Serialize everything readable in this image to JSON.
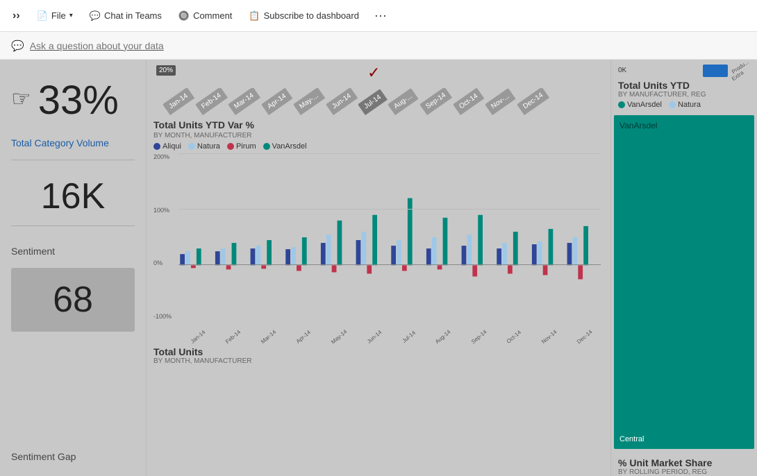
{
  "toolbar": {
    "chevron_label": "›",
    "file_label": "File",
    "chat_label": "Chat in Teams",
    "comment_label": "Comment",
    "subscribe_label": "Subscribe to dashboard",
    "more_label": "···"
  },
  "search": {
    "placeholder": "Ask a question about your data"
  },
  "left": {
    "percent": "33%",
    "category_label": "Total Category Volume",
    "units": "16K",
    "sentiment_label": "Sentiment",
    "sentiment_value": "68",
    "sentiment_gap_label": "Sentiment Gap"
  },
  "mid_slider": {
    "pct": "20%",
    "months": [
      "Jan-14",
      "Feb-14",
      "Mar-14",
      "Apr-14",
      "May-...",
      "Jun-14",
      "Jul-14",
      "Aug-...",
      "Sep-14",
      "Oct-14",
      "Nov-...",
      "Dec-14"
    ]
  },
  "chart": {
    "title": "Total Units YTD Var %",
    "subtitle": "BY MONTH, MANUFACTURER",
    "legend": [
      {
        "name": "Aliqui",
        "color": "#2e4698"
      },
      {
        "name": "Natura",
        "color": "#9ec8e8"
      },
      {
        "name": "Pirum",
        "color": "#c0334d"
      },
      {
        "name": "VanArsdel",
        "color": "#00897b"
      }
    ],
    "y_labels": [
      "200%",
      "100%",
      "0%",
      "-100%"
    ],
    "x_labels": [
      "Jan-14",
      "Feb-14",
      "Mar-14",
      "Apr-14",
      "May-14",
      "Jun-14",
      "Jul-14",
      "Aug-14",
      "Sep-14",
      "Oct-14",
      "Nov-14",
      "Dec-14"
    ],
    "bar_groups": [
      {
        "aliqui": 20,
        "natura": 25,
        "pirum": -5,
        "vanarsdel": 30
      },
      {
        "aliqui": 25,
        "natura": 30,
        "pirum": -8,
        "vanarsdel": 40
      },
      {
        "aliqui": 30,
        "natura": 35,
        "pirum": -6,
        "vanarsdel": 45
      },
      {
        "aliqui": 28,
        "natura": 32,
        "pirum": -10,
        "vanarsdel": 50
      },
      {
        "aliqui": 40,
        "natura": 55,
        "pirum": -12,
        "vanarsdel": 80
      },
      {
        "aliqui": 45,
        "natura": 60,
        "pirum": -15,
        "vanarsdel": 90
      },
      {
        "aliqui": 35,
        "natura": 45,
        "pirum": -10,
        "vanarsdel": 120
      },
      {
        "aliqui": 30,
        "natura": 50,
        "pirum": -8,
        "vanarsdel": 85
      },
      {
        "aliqui": 35,
        "natura": 55,
        "pirum": -20,
        "vanarsdel": 90
      },
      {
        "aliqui": 30,
        "natura": 40,
        "pirum": -15,
        "vanarsdel": 60
      },
      {
        "aliqui": 38,
        "natura": 42,
        "pirum": -18,
        "vanarsdel": 65
      },
      {
        "aliqui": 40,
        "natura": 50,
        "pirum": -25,
        "vanarsdel": 70
      }
    ]
  },
  "bottom_left": {
    "title": "Total Units",
    "subtitle": "BY MONTH, MANUFACTURER"
  },
  "right": {
    "title": "Total Units YTD",
    "subtitle": "BY MANUFACTURER, REG",
    "legend": [
      {
        "name": "VanArsdel",
        "color": "#00897b"
      },
      {
        "name": "Natura",
        "color": "#9ec8e8"
      }
    ],
    "zero_label": "0K",
    "vanarsdel_label": "VanArsdel",
    "central_label": "Central",
    "bottom_title": "% Unit Market Share",
    "bottom_subtitle": "BY ROLLING PERIOD, REG"
  }
}
